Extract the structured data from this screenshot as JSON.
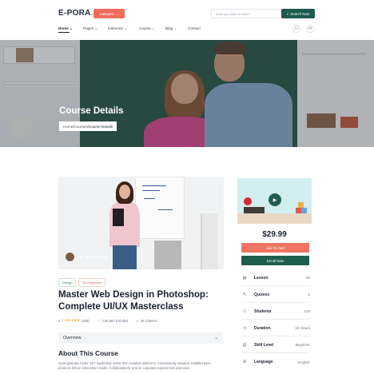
{
  "header": {
    "logo_main": "E-PORA",
    "logo_dot": ".",
    "category_label": "Categorie",
    "search_placeholder": "What you want to learn?",
    "search_button": "Search Now",
    "nav": [
      {
        "label": "Home"
      },
      {
        "label": "Pages"
      },
      {
        "label": "Instructor"
      },
      {
        "label": "Course"
      },
      {
        "label": "Blog"
      },
      {
        "label": "Contact"
      }
    ],
    "user_icon": "user-icon",
    "bag_icon": "shopping-bag-icon"
  },
  "hero": {
    "title": "Course Details",
    "breadcrumb_home": "Home",
    "breadcrumb_sep1": " / ",
    "breadcrumb_courses": "Courses",
    "breadcrumb_sep2": " / ",
    "breadcrumb_current": "Course Details"
  },
  "course": {
    "author_prefix": "By",
    "author_name": "Emilia Jonas",
    "tags": [
      "Design",
      "Development"
    ],
    "title": "Master Web Design in Photoshop: Complete UI/UX Masterclass",
    "rating": "4.7",
    "stars": "★★★★★",
    "reviews": "(108)",
    "enrolled": "2,56,687 Enrolled",
    "classes": "36 Classes",
    "overview_label": "Overview",
    "about_heading": "About This Course",
    "about_text": "Synergistically foster 24/7 leadership rather than scalable platforms. Conveniently visualize installed base products before interactive results. Collaboratively restore corporate experiences and open-"
  },
  "sidebar": {
    "price": "$29.99",
    "add_to_cart": "Add To Cart",
    "enroll": "Enroll Now",
    "info": [
      {
        "icon": "lesson-icon",
        "label": "Lesson",
        "value": "36"
      },
      {
        "icon": "quiz-icon",
        "label": "Quizess",
        "value": "6"
      },
      {
        "icon": "students-icon",
        "label": "Students",
        "value": "105"
      },
      {
        "icon": "clock-icon",
        "label": "Duration",
        "value": "15 Hours"
      },
      {
        "icon": "skill-icon",
        "label": "Skill Level",
        "value": "Beginner"
      },
      {
        "icon": "globe-icon",
        "label": "Language",
        "value": "English"
      }
    ]
  },
  "colors": {
    "accent_orange": "#f07462",
    "brand_green": "#1f5d50",
    "star": "#f5a623"
  }
}
